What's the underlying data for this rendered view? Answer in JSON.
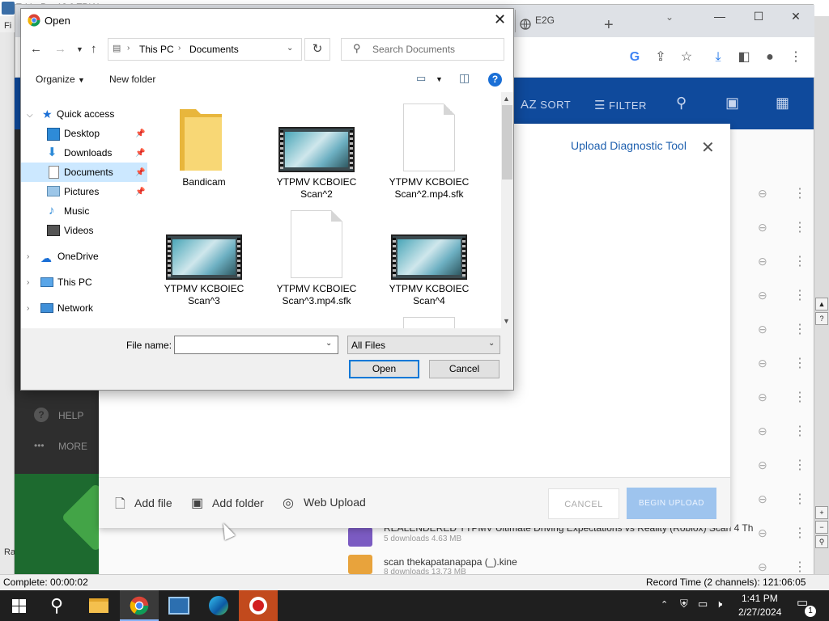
{
  "recorder": {
    "title": "ToV... Pro 13.0 TRIAL",
    "menu_label": "Fi",
    "ra_label": "Ra",
    "status_left": "Complete: 00:00:02",
    "status_right": "Record Time (2 channels): 121:06:05"
  },
  "browser": {
    "tab_label": "E2G",
    "tab_close": "×",
    "new_tab": "+",
    "dropdown": "⌄"
  },
  "app": {
    "header": {
      "sort": "SORT",
      "sort_prefix": "AZ",
      "filter": "FILTER"
    },
    "sidebar": {
      "help": "HELP",
      "more": "MORE"
    },
    "list_items": [
      {
        "title": "REALENDERED YTPMV Ultimate Driving Expectations vs Reality (Roblox) Scan 4 Th",
        "sub": "5 downloads  4.63 MB"
      },
      {
        "title": "scan thekapatanapapa (_).kine",
        "sub": "8 downloads  13.73 MB"
      }
    ],
    "upload_modal": {
      "title": "Upload Diagnostic Tool",
      "add_file": "Add file",
      "add_folder": "Add folder",
      "web_upload": "Web Upload",
      "cancel": "CANCEL",
      "begin_upload": "BEGIN UPLOAD"
    }
  },
  "dialog": {
    "title": "Open",
    "breadcrumb": [
      "This PC",
      "Documents"
    ],
    "search_placeholder": "Search Documents",
    "organize": "Organize",
    "new_folder": "New folder",
    "help": "?",
    "nav": {
      "quick_access": "Quick access",
      "desktop": "Desktop",
      "downloads": "Downloads",
      "documents": "Documents",
      "pictures": "Pictures",
      "music": "Music",
      "videos": "Videos",
      "onedrive": "OneDrive",
      "this_pc": "This PC",
      "network": "Network"
    },
    "files": [
      {
        "line1": "Bandicam",
        "line2": ""
      },
      {
        "line1": "YTPMV KCBOIEC",
        "line2": "Scan^2"
      },
      {
        "line1": "YTPMV KCBOIEC",
        "line2": "Scan^2.mp4.sfk"
      },
      {
        "line1": "YTPMV KCBOIEC",
        "line2": "Scan^3"
      },
      {
        "line1": "YTPMV KCBOIEC",
        "line2": "Scan^3.mp4.sfk"
      },
      {
        "line1": "YTPMV KCBOIEC",
        "line2": "Scan^4"
      }
    ],
    "file_name_label": "File name:",
    "file_name_value": "",
    "file_type": "All Files",
    "open_button": "Open",
    "cancel_button": "Cancel"
  },
  "taskbar": {
    "time": "1:41 PM",
    "date": "2/27/2024",
    "notifications": "1"
  },
  "colors": {
    "app_header": "#0f4a9c",
    "begin_upload": "#9ec4ee",
    "selection": "#cce8ff",
    "open_border": "#0078d7"
  }
}
